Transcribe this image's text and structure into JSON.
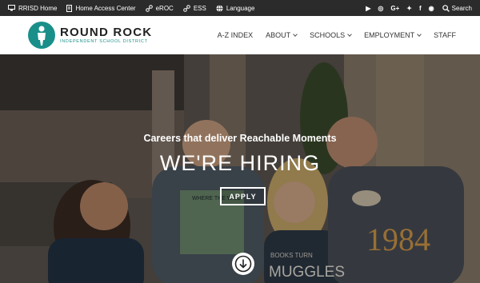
{
  "topbar": {
    "links": [
      {
        "label": "RRISD Home",
        "icon": "monitor-icon"
      },
      {
        "label": "Home Access Center",
        "icon": "document-icon"
      },
      {
        "label": "eROC",
        "icon": "link-icon"
      },
      {
        "label": "ESS",
        "icon": "link-icon"
      },
      {
        "label": "Language",
        "icon": "globe-icon"
      }
    ],
    "social": [
      "youtube-icon",
      "instagram-icon",
      "google-plus-icon",
      "twitter-icon",
      "facebook-icon",
      "rss-icon"
    ],
    "social_glyphs": [
      "▶",
      "◎",
      "G+",
      "✦",
      "f",
      "◉"
    ],
    "search_label": "Search"
  },
  "header": {
    "logo_title": "ROUND ROCK",
    "logo_subtitle": "INDEPENDENT SCHOOL DISTRICT",
    "nav": [
      {
        "label": "A-Z INDEX",
        "dropdown": false
      },
      {
        "label": "ABOUT",
        "dropdown": true
      },
      {
        "label": "SCHOOLS",
        "dropdown": true
      },
      {
        "label": "EMPLOYMENT",
        "dropdown": true
      },
      {
        "label": "STAFF",
        "dropdown": false
      }
    ]
  },
  "hero": {
    "subtitle": "Careers that deliver Reachable Moments",
    "title": "WE'RE HIRING",
    "cta_label": "APPLY",
    "shirt_text_1": "BOOKS TURN",
    "shirt_text_2": "MUGGLES",
    "shirt_text_3": "WHERE THE WILD",
    "shirt_text_4": "1984"
  },
  "colors": {
    "topbar_bg": "#2b2b2b",
    "brand_teal": "#1a8f8a",
    "header_bg": "#ffffff"
  }
}
